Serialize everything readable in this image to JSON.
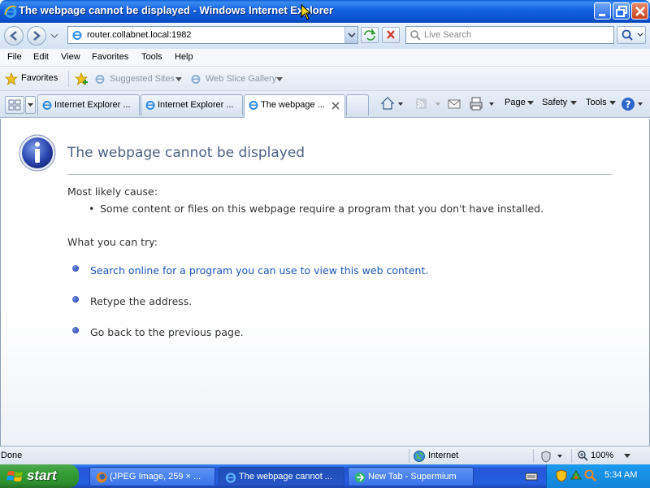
{
  "window": {
    "title": "The webpage cannot be displayed - Windows Internet Explorer"
  },
  "address_bar": {
    "url": "router.collabnet.local:1982",
    "search_placeholder": "Live Search"
  },
  "menu": {
    "items": [
      "File",
      "Edit",
      "View",
      "Favorites",
      "Tools",
      "Help"
    ]
  },
  "favorites_bar": {
    "favorites_label": "Favorites",
    "suggested_sites": "Suggested Sites",
    "web_slice_gallery": "Web Slice Gallery"
  },
  "tabs": [
    {
      "label": "Internet Explorer ..."
    },
    {
      "label": "Internet Explorer ..."
    },
    {
      "label": "The webpage ..."
    }
  ],
  "command_bar": {
    "page": "Page",
    "safety": "Safety",
    "tools": "Tools"
  },
  "content": {
    "title": "The webpage cannot be displayed",
    "likely_cause_heading": "Most likely cause:",
    "likely_cause_item": "Some content or files on this webpage require a program that you don't have installed.",
    "what_to_try_heading": "What you can try:",
    "try_items": [
      "Search online for a program you can use to view this web content.",
      "Retype the address.",
      "Go back to the previous page."
    ]
  },
  "status_bar": {
    "status": "Done",
    "zone": "Internet",
    "zoom": "100%"
  },
  "taskbar": {
    "start_label": "start",
    "tasks": [
      {
        "label": "(JPEG Image, 259 × ..."
      },
      {
        "label": "The webpage cannot ..."
      },
      {
        "label": "New Tab - Supermium"
      }
    ],
    "clock": "5:34 AM"
  },
  "colors": {
    "title_bar": "#0a52cf",
    "error_title": "#4d6185",
    "link": "#1c56b8",
    "start_button": "#38a038"
  }
}
